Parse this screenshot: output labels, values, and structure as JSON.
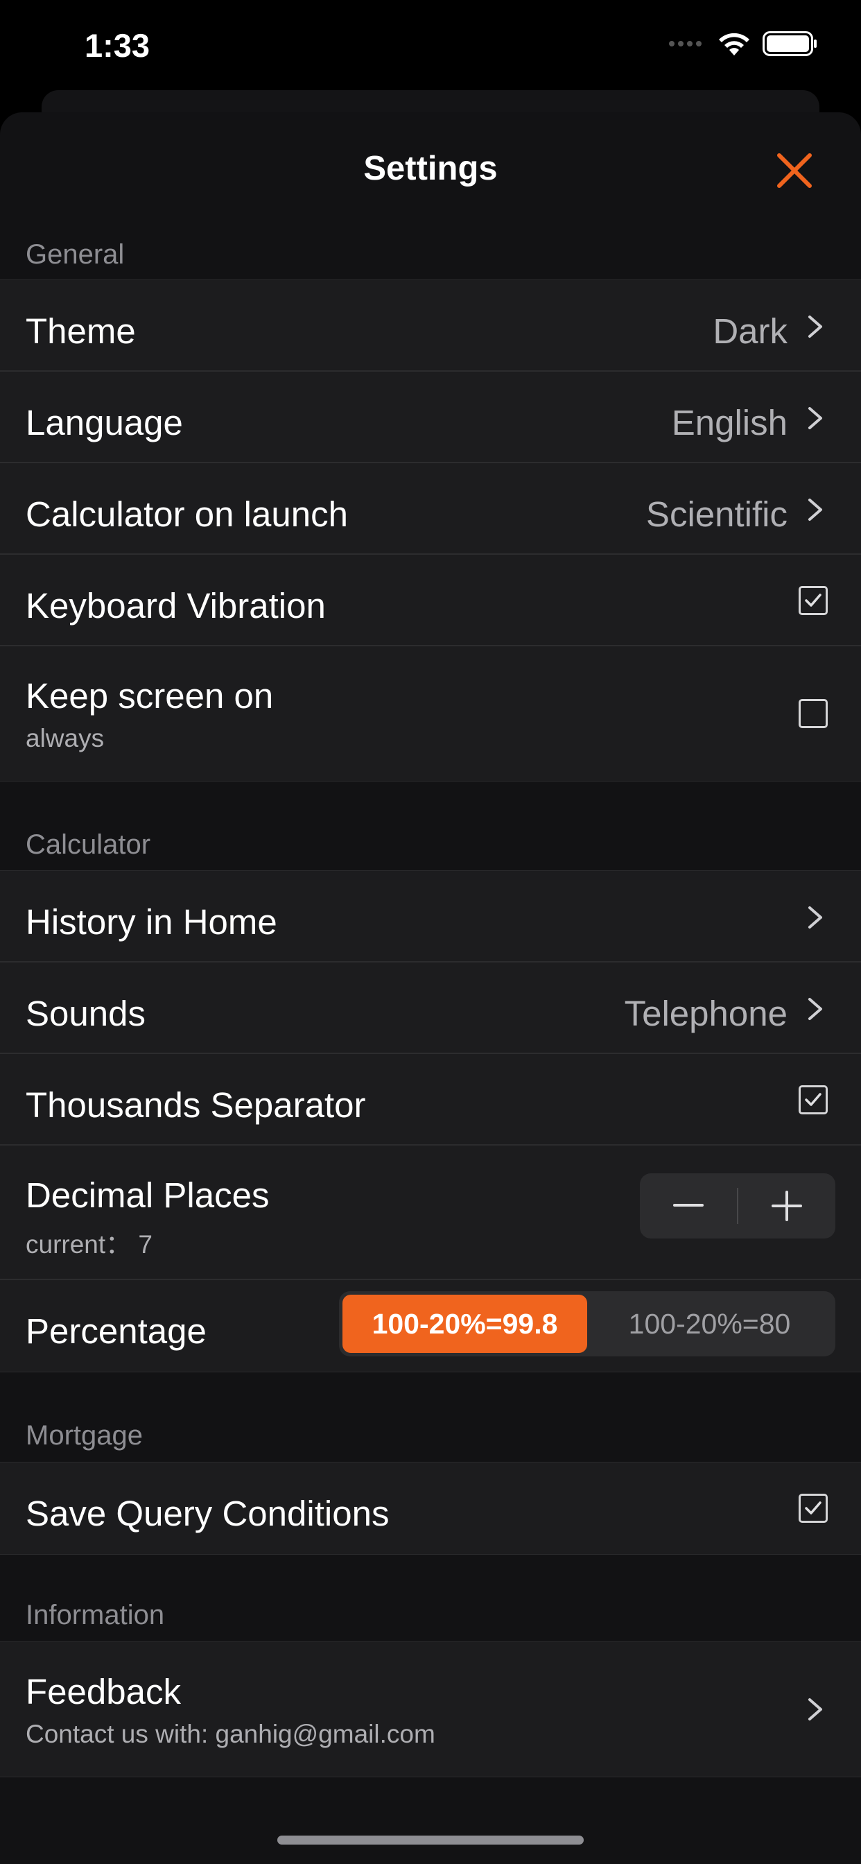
{
  "status_bar": {
    "time": "1:33"
  },
  "nav": {
    "title": "Settings",
    "close_icon": "close-icon"
  },
  "colors": {
    "accent": "#f0641e",
    "background": "#121214",
    "cell": "#1c1c1e"
  },
  "sections": {
    "general": {
      "header": "General",
      "theme": {
        "label": "Theme",
        "value": "Dark"
      },
      "language": {
        "label": "Language",
        "value": "English"
      },
      "calculator_on_launch": {
        "label": "Calculator on launch",
        "value": "Scientific"
      },
      "keyboard_vibration": {
        "label": "Keyboard Vibration",
        "checked": true
      },
      "keep_screen_on": {
        "label": "Keep screen on",
        "sublabel": "always",
        "checked": false
      }
    },
    "calculator": {
      "header": "Calculator",
      "history_in_home": {
        "label": "History in Home"
      },
      "sounds": {
        "label": "Sounds",
        "value": "Telephone"
      },
      "thousands_separator": {
        "label": "Thousands Separator",
        "checked": true
      },
      "decimal_places": {
        "label": "Decimal Places",
        "sublabel": "current：  7",
        "minus": "−",
        "plus": "+"
      },
      "percentage": {
        "label": "Percentage",
        "options": [
          "100-20%=99.8",
          "100-20%=80"
        ],
        "selected_index": 0
      }
    },
    "mortgage": {
      "header": "Mortgage",
      "save_query_conditions": {
        "label": "Save Query Conditions",
        "checked": true
      }
    },
    "information": {
      "header": "Information",
      "feedback": {
        "label": "Feedback",
        "sublabel": "Contact us with: ganhig@gmail.com"
      }
    }
  }
}
